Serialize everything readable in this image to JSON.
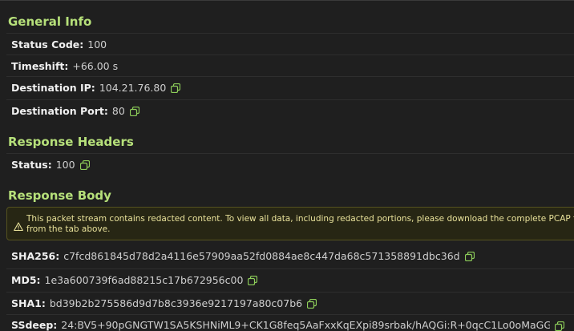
{
  "general_info": {
    "title": "General Info",
    "status_code": {
      "label": "Status Code:",
      "value": "100"
    },
    "timeshift": {
      "label": "Timeshift:",
      "value": "+66.00 s"
    },
    "destination_ip": {
      "label": "Destination IP:",
      "value": "104.21.76.80"
    },
    "destination_port": {
      "label": "Destination Port:",
      "value": "80"
    }
  },
  "response_headers": {
    "title": "Response Headers",
    "status": {
      "label": "Status:",
      "value": "100"
    }
  },
  "response_body": {
    "title": "Response Body",
    "notice": "This packet stream contains redacted content. To view all data, including redacted portions, please download the complete PCAP file from the tab above.",
    "sha256": {
      "label": "SHA256:",
      "value": "c7fcd861845d78d2a4116e57909aa52fd0884ae8c447da68c571358891dbc36d"
    },
    "md5": {
      "label": "MD5:",
      "value": "1e3a600739f6ad88215c17b672956c00"
    },
    "sha1": {
      "label": "SHA1:",
      "value": "bd39b2b275586d9d7b8c3936e9217197a80c07b6"
    },
    "ssdeep": {
      "label": "SSdeep:",
      "value": "24:BV5+90pGNGTW1SA5KSHNiML9+CK1G8feq5AaFxxKqEXpi89srbak/hAQGi:R+0qcC1Lo0oMaGG..."
    }
  },
  "colors": {
    "accent": "#b6e07a",
    "background": "#1f1f1f",
    "warning_bg": "#272614",
    "warning_text": "#e8e19a",
    "copy_icon": "#8ecf5a"
  }
}
